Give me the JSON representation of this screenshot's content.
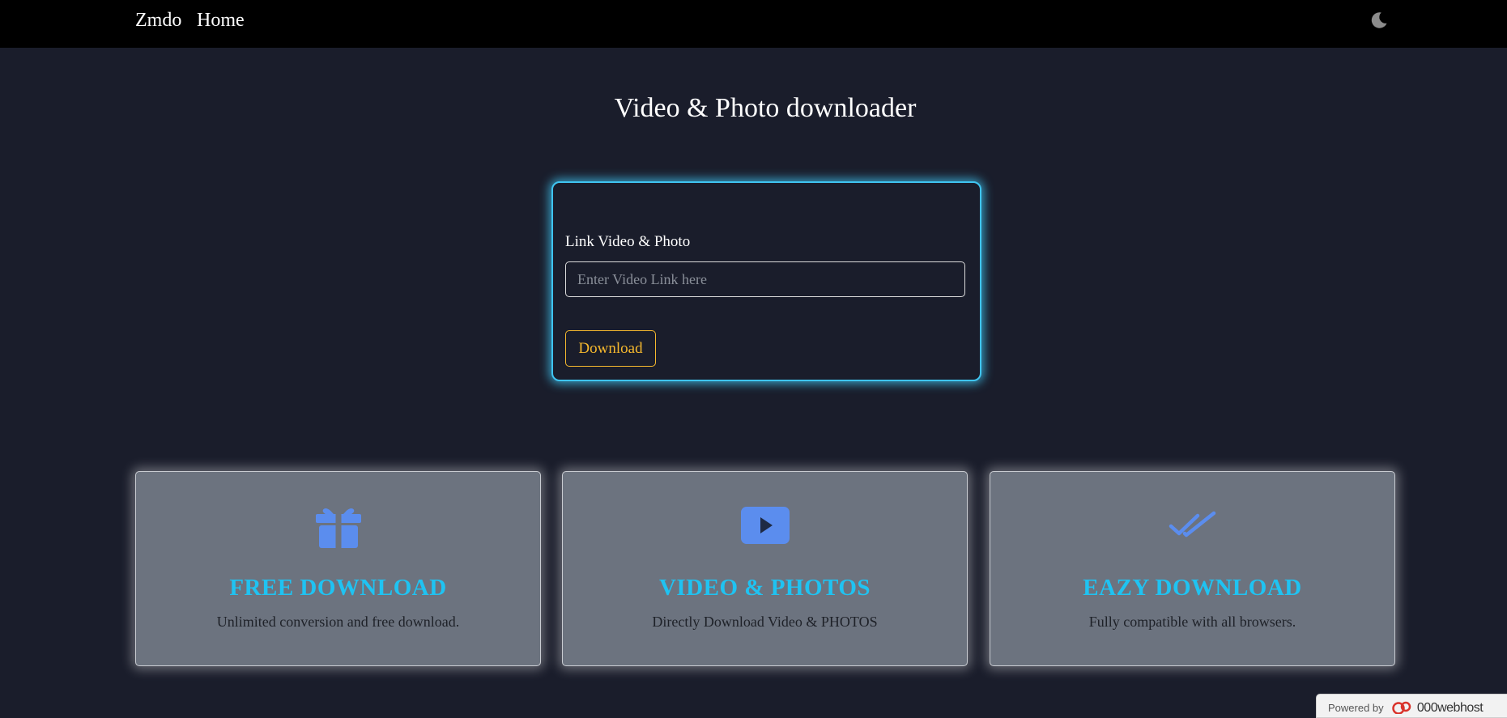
{
  "navbar": {
    "brand": "Zmdo",
    "home": "Home",
    "theme_icon": "moon-icon"
  },
  "main": {
    "title": "Video & Photo downloader",
    "form": {
      "label": "Link Video & Photo",
      "input_placeholder": "Enter Video Link here",
      "input_value": "",
      "button_label": "Download"
    }
  },
  "features": [
    {
      "icon": "gift-icon",
      "title": "FREE DOWNLOAD",
      "description": "Unlimited conversion and free download."
    },
    {
      "icon": "video-play-icon",
      "title": "VIDEO & PHOTOS",
      "description": "Directly Download Video & PHOTOS"
    },
    {
      "icon": "double-check-icon",
      "title": "EAZY DOWNLOAD",
      "description": "Fully compatible with all browsers."
    }
  ],
  "footer_badge": {
    "prefix": "Powered by",
    "host": "000webhost",
    "icon": "000webhost-logo-icon"
  },
  "colors": {
    "background": "#1a1d2b",
    "navbar": "#000000",
    "form_glow": "#3fc4f0",
    "button_accent": "#f5b82e",
    "feature_card": "#6c737f",
    "feature_title": "#1fc3f2",
    "feature_icon": "#5b8dee"
  }
}
